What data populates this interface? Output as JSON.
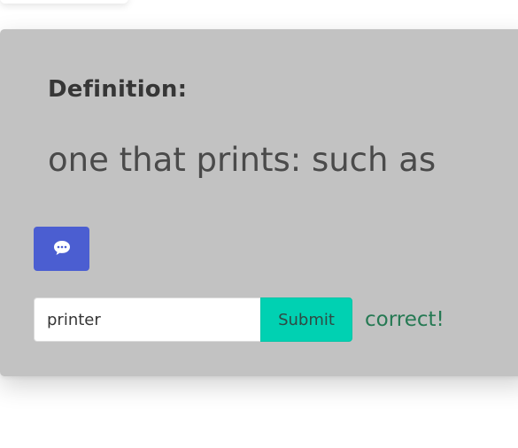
{
  "definition": {
    "label": "Definition:",
    "text": "one that prints: such as"
  },
  "hint_button": {
    "icon": "speech-bubble-icon",
    "color": "#4b5ed1"
  },
  "answer": {
    "input_value": "printer",
    "submit_label": "Submit",
    "submit_color": "#00d1b2",
    "result_text": "correct!",
    "result_color": "#257953"
  },
  "card": {
    "background": "#c2c2c2"
  }
}
